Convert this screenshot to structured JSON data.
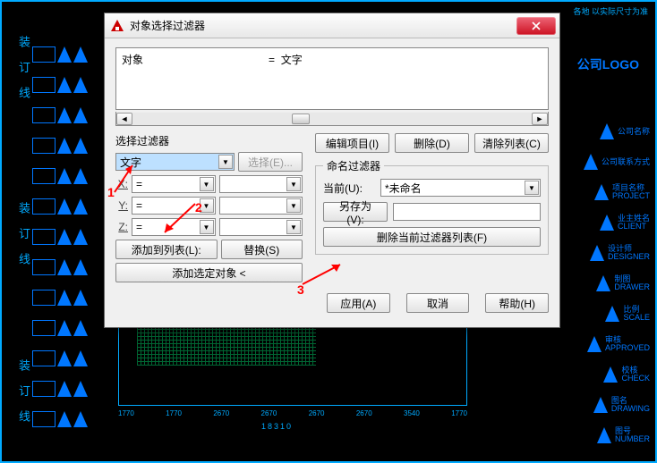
{
  "cad": {
    "title_right": "各地 以实际尺寸为准",
    "logo": "公司LOGO",
    "binding_text": "装 订 线",
    "right_items": [
      {
        "zh": "公司名称",
        "en": ""
      },
      {
        "zh": "公司联系方式",
        "en": ""
      },
      {
        "zh": "项目名称",
        "en": "PROJECT"
      },
      {
        "zh": "业主姓名",
        "en": "CLIENT"
      },
      {
        "zh": "设计师",
        "en": "DESIGNER"
      },
      {
        "zh": "制图",
        "en": "DRAWER"
      },
      {
        "zh": "比例",
        "en": "SCALE"
      },
      {
        "zh": "审核",
        "en": "APPROVED"
      },
      {
        "zh": "校核",
        "en": "CHECK"
      },
      {
        "zh": "图名",
        "en": "DRAWING"
      },
      {
        "zh": "图号",
        "en": "NUMBER"
      }
    ],
    "dims": [
      "1770",
      "1770",
      "2670",
      "2670",
      "2670",
      "2670",
      "3540",
      "1770"
    ],
    "dim_total": "18310"
  },
  "dialog": {
    "title": "对象选择过滤器",
    "list_object_label": "对象",
    "list_eq": "=",
    "list_value": "文字",
    "group_select_filter": "选择过滤器",
    "combo_main": "文字",
    "btn_select": "选择(E)...",
    "xyz": {
      "x": "X:",
      "y": "Y:",
      "z": "Z:",
      "op": "="
    },
    "btn_add_list": "添加到列表(L):",
    "btn_replace": "替换(S)",
    "btn_add_sel": "添加选定对象 <",
    "btn_edit_item": "编辑项目(I)",
    "btn_delete": "删除(D)",
    "btn_clear_list": "清除列表(C)",
    "group_named": "命名过滤器",
    "lbl_current": "当前(U):",
    "current_value": "*未命名",
    "lbl_saveas": "另存为(V):",
    "btn_del_current": "删除当前过滤器列表(F)",
    "btn_apply": "应用(A)",
    "btn_cancel": "取消",
    "btn_help": "帮助(H)"
  },
  "annotations": {
    "n1": "1",
    "n2": "2",
    "n3": "3"
  }
}
